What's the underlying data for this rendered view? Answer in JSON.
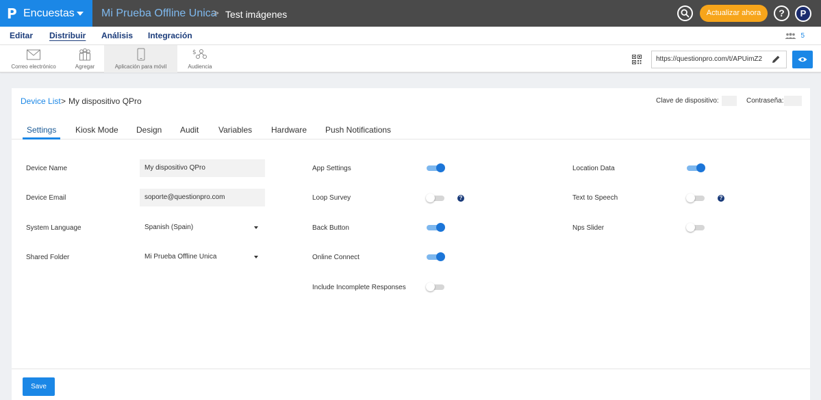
{
  "topbar": {
    "logo_glyph": "P",
    "product": "Encuestas",
    "survey_title": "Mi Prueba Offline Unica",
    "breadcrumb_separator": ">",
    "folder_title": "Test imágenes",
    "upgrade_label": "Actualizar ahora",
    "help_glyph": "?",
    "account_glyph": "P",
    "brand_color": "#1b87e6",
    "upgrade_color": "#f7a51b"
  },
  "mainnav": {
    "items": [
      {
        "label": "Editar",
        "active": false
      },
      {
        "label": "Distribuir",
        "active": true
      },
      {
        "label": "Análisis",
        "active": false
      },
      {
        "label": "Integración",
        "active": false
      }
    ],
    "users_count": "5"
  },
  "subnav": {
    "items": [
      {
        "label": "Correo electrónico",
        "icon": "envelope-icon"
      },
      {
        "label": "Agregar",
        "icon": "people-icon"
      },
      {
        "label": "Aplicación para móvil",
        "icon": "mobile-icon",
        "active": true
      },
      {
        "label": "Audiencia",
        "icon": "audience-icon"
      }
    ],
    "survey_url": "https://questionpro.com/t/APUimZ2"
  },
  "device": {
    "breadcrumb_link": "Device List",
    "breadcrumb_sep": ">",
    "breadcrumb_current": "My dispositivo QPro",
    "device_key_label": "Clave de dispositivo:",
    "device_key_value": "",
    "password_label": "Contraseña:",
    "password_value": "",
    "tabs": [
      "Settings",
      "Kiosk Mode",
      "Design",
      "Audit",
      "Variables",
      "Hardware",
      "Push Notifications"
    ],
    "active_tab": "Settings"
  },
  "fields": {
    "device_name": {
      "label": "Device Name",
      "value": "My dispositivo QPro"
    },
    "device_email": {
      "label": "Device Email",
      "value": "soporte@questionpro.com"
    },
    "system_language": {
      "label": "System Language",
      "value": "Spanish (Spain)"
    },
    "shared_folder": {
      "label": "Shared Folder",
      "value": "Mi Prueba Offline Unica"
    }
  },
  "toggles_middle": [
    {
      "label": "App Settings",
      "on": true,
      "help": false
    },
    {
      "label": "Loop Survey",
      "on": false,
      "help": true
    },
    {
      "label": "Back Button",
      "on": true,
      "help": false
    },
    {
      "label": "Online Connect",
      "on": true,
      "help": false
    },
    {
      "label": "Include Incomplete Responses",
      "on": false,
      "help": false
    }
  ],
  "toggles_right": [
    {
      "label": "Location Data",
      "on": true,
      "help": false
    },
    {
      "label": "Text to Speech",
      "on": false,
      "help": true
    },
    {
      "label": "Nps Slider",
      "on": false,
      "help": false
    }
  ],
  "help_glyph": "?",
  "save_label": "Save"
}
